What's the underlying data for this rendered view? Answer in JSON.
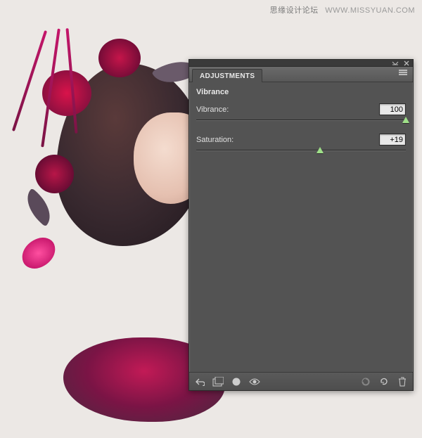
{
  "watermark": {
    "cn": "思缘设计论坛",
    "url": "WWW.MISSYUAN.COM"
  },
  "panel": {
    "tab": "ADJUSTMENTS",
    "title": "Vibrance",
    "controls": {
      "vibrance": {
        "label": "Vibrance:",
        "value": "100",
        "pos_pct": 100
      },
      "saturation": {
        "label": "Saturation:",
        "value": "+19",
        "pos_pct": 59
      }
    },
    "icons": {
      "collapse": "collapse-icon",
      "close": "close-icon",
      "menu": "panel-menu-icon",
      "back": "back-arrow-icon",
      "new_adj": "new-adjustment-icon",
      "clip": "clip-to-layer-icon",
      "visibility": "visibility-eye-icon",
      "prev_state": "previous-state-icon",
      "reset": "reset-icon",
      "trash": "trash-icon"
    }
  }
}
